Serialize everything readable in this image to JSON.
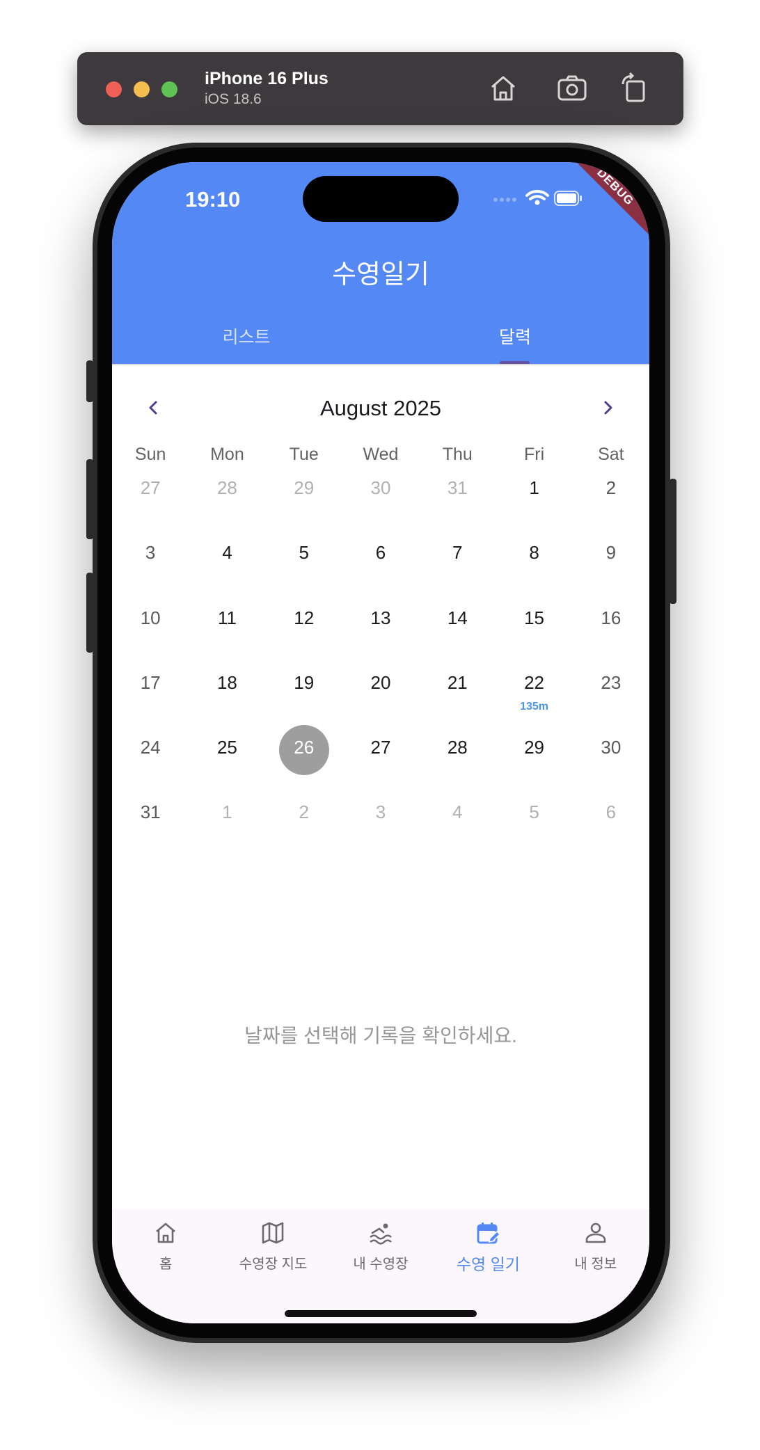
{
  "simulator": {
    "device_name": "iPhone 16 Plus",
    "os_version": "iOS 18.6",
    "icons": [
      "home-icon",
      "screenshot-icon",
      "rotate-icon"
    ]
  },
  "status_bar": {
    "time": "19:10",
    "debug_label": "DEBUG"
  },
  "app_bar": {
    "title": "수영일기",
    "tabs": [
      {
        "label": "리스트",
        "active": false
      },
      {
        "label": "달력",
        "active": true
      }
    ]
  },
  "calendar": {
    "month_title": "August 2025",
    "weekdays": [
      "Sun",
      "Mon",
      "Tue",
      "Wed",
      "Thu",
      "Fri",
      "Sat"
    ],
    "weeks": [
      [
        {
          "d": "27",
          "o": true
        },
        {
          "d": "28",
          "o": true
        },
        {
          "d": "29",
          "o": true
        },
        {
          "d": "30",
          "o": true
        },
        {
          "d": "31",
          "o": true
        },
        {
          "d": "1"
        },
        {
          "d": "2"
        }
      ],
      [
        {
          "d": "3"
        },
        {
          "d": "4"
        },
        {
          "d": "5"
        },
        {
          "d": "6"
        },
        {
          "d": "7"
        },
        {
          "d": "8"
        },
        {
          "d": "9"
        }
      ],
      [
        {
          "d": "10"
        },
        {
          "d": "11"
        },
        {
          "d": "12"
        },
        {
          "d": "13"
        },
        {
          "d": "14"
        },
        {
          "d": "15"
        },
        {
          "d": "16"
        }
      ],
      [
        {
          "d": "17"
        },
        {
          "d": "18"
        },
        {
          "d": "19"
        },
        {
          "d": "20"
        },
        {
          "d": "21"
        },
        {
          "d": "22",
          "mark": "135m"
        },
        {
          "d": "23"
        }
      ],
      [
        {
          "d": "24"
        },
        {
          "d": "25"
        },
        {
          "d": "26",
          "selected": true
        },
        {
          "d": "27"
        },
        {
          "d": "28"
        },
        {
          "d": "29"
        },
        {
          "d": "30"
        }
      ],
      [
        {
          "d": "31"
        },
        {
          "d": "1",
          "o": true
        },
        {
          "d": "2",
          "o": true
        },
        {
          "d": "3",
          "o": true
        },
        {
          "d": "4",
          "o": true
        },
        {
          "d": "5",
          "o": true
        },
        {
          "d": "6",
          "o": true
        }
      ]
    ]
  },
  "empty_message": "날짜를 선택해 기록을 확인하세요.",
  "bottom_nav": [
    {
      "label": "홈",
      "icon": "home-icon",
      "active": false
    },
    {
      "label": "수영장 지도",
      "icon": "map-icon",
      "active": false
    },
    {
      "label": "내 수영장",
      "icon": "swimmer-icon",
      "active": false
    },
    {
      "label": "수영 일기",
      "icon": "calendar-edit-icon",
      "active": true
    },
    {
      "label": "내 정보",
      "icon": "person-icon",
      "active": false
    }
  ],
  "colors": {
    "primary": "#5488f5",
    "selected_day": "#9e9e9e",
    "distance_mark": "#4b94ea",
    "nav_background": "#fcf7fd",
    "debug_banner": "#8b3043"
  }
}
